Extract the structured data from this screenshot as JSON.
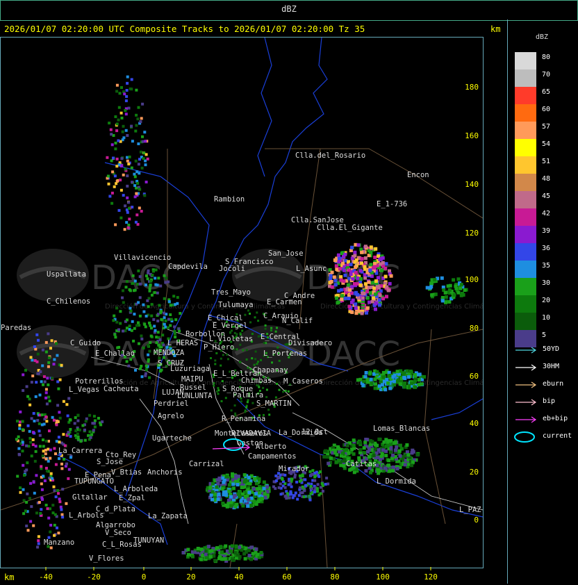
{
  "header": {
    "title": "dBZ"
  },
  "caption": "2026/01/07 02:20:00 UTC Composite Tracks to 2026/01/07 02:20:00 Tz 35",
  "axis": {
    "unit_top": "km",
    "unit_bottom": "km",
    "y_ticks": [
      "180",
      "160",
      "140",
      "120",
      "100",
      "80",
      "60",
      "40",
      "20",
      "0"
    ],
    "x_ticks": [
      "-40",
      "-20",
      "0",
      "20",
      "40",
      "60",
      "80",
      "100",
      "120"
    ]
  },
  "legend": {
    "title": "dBZ",
    "colors": [
      {
        "value": "80",
        "color": "#d9d9d9"
      },
      {
        "value": "70",
        "color": "#bdbdbd"
      },
      {
        "value": "65",
        "color": "#ff3b2a"
      },
      {
        "value": "60",
        "color": "#ff6a10"
      },
      {
        "value": "57",
        "color": "#ff9a5a"
      },
      {
        "value": "54",
        "color": "#ffff00"
      },
      {
        "value": "51",
        "color": "#ffc62e"
      },
      {
        "value": "48",
        "color": "#d2884a"
      },
      {
        "value": "45",
        "color": "#c06a8a"
      },
      {
        "value": "42",
        "color": "#c81a95"
      },
      {
        "value": "39",
        "color": "#8a1ad0"
      },
      {
        "value": "36",
        "color": "#3346e8"
      },
      {
        "value": "35",
        "color": "#1e8ee0"
      },
      {
        "value": "30",
        "color": "#1aa01a"
      },
      {
        "value": "20",
        "color": "#0d7a0d"
      },
      {
        "value": "10",
        "color": "#0b5c0b"
      },
      {
        "value": "5",
        "color": "#4a3c8a"
      }
    ],
    "tracks": [
      {
        "label": "50YD",
        "color": "#4fd6e0"
      },
      {
        "label": "30HM",
        "color": "#ffffff"
      },
      {
        "label": "eburn",
        "color": "#f0c080"
      },
      {
        "label": "bip",
        "color": "#ffc0d0"
      },
      {
        "label": "eb+bip",
        "color": "#ff40ff"
      },
      {
        "label": "current",
        "color": "#00e5ff"
      }
    ]
  },
  "places": [
    "Clla.del_Rosario",
    "Encon",
    "Rambion",
    "E_1-736",
    "Clla.SanJose",
    "Clla.El_Gigante",
    "Villavicencio",
    "Uspallata",
    "Capdevila",
    "S_Francisco",
    "San_Jose",
    "L_Asunc",
    "Jocoli",
    "Tres_Mayo",
    "Tulumaya",
    "E_Carmen",
    "C_Andre",
    "C_Chilenos",
    "E_Chical",
    "E_Vergel",
    "C_Arauio",
    "N_Calif",
    "Paredas",
    "Borbollon",
    "L_Violetas",
    "E_Central",
    "Divisadero",
    "C_Guido",
    "L_HERAS",
    "P_Hiero",
    "L_Portenas",
    "MENDOZA",
    "E_Challao",
    "S_CRUZ",
    "Luzuriaga",
    "E_L_Beltran",
    "Chapanay",
    "Potrerillos",
    "Cacheuta",
    "MAIPU",
    "Russel",
    "Chimbas",
    "M_Caseros",
    "L_Vegas",
    "LUJAN",
    "LUNLUNTA",
    "S_Roque",
    "Palmira",
    "Perdriel",
    "S_MARTIN",
    "Agrelo",
    "R_Penamina",
    "Montecaseros",
    "Ugarteche",
    "RIVADAVIA",
    "La_Dormida",
    "Lomas_Blancas",
    "12_Oct",
    "La_Carrera",
    "Cto_Rey",
    "S_Jose",
    "Carrizal",
    "Gaston",
    "Alberto",
    "Campamentos",
    "E_Pena",
    "V_Btias",
    "Anchoris",
    "TUPUNGATO",
    "Mirador",
    "Catitas",
    "L_Dormida",
    "L_Arboleda",
    "Gltallar",
    "E_Zpal",
    "C_d_Plata",
    "L_Arbols",
    "La_Zapata",
    "Algarrobo",
    "V_Seco",
    "Manzano",
    "TUNUYAN",
    "C_L_Rosas",
    "V_Flores",
    "L_PAZ"
  ],
  "watermarks": [
    "DACC",
    "DACC",
    "DACC",
    "DACC"
  ],
  "watermark_sub": "Dirección de Agricultura y Contingencias Climáticas"
}
